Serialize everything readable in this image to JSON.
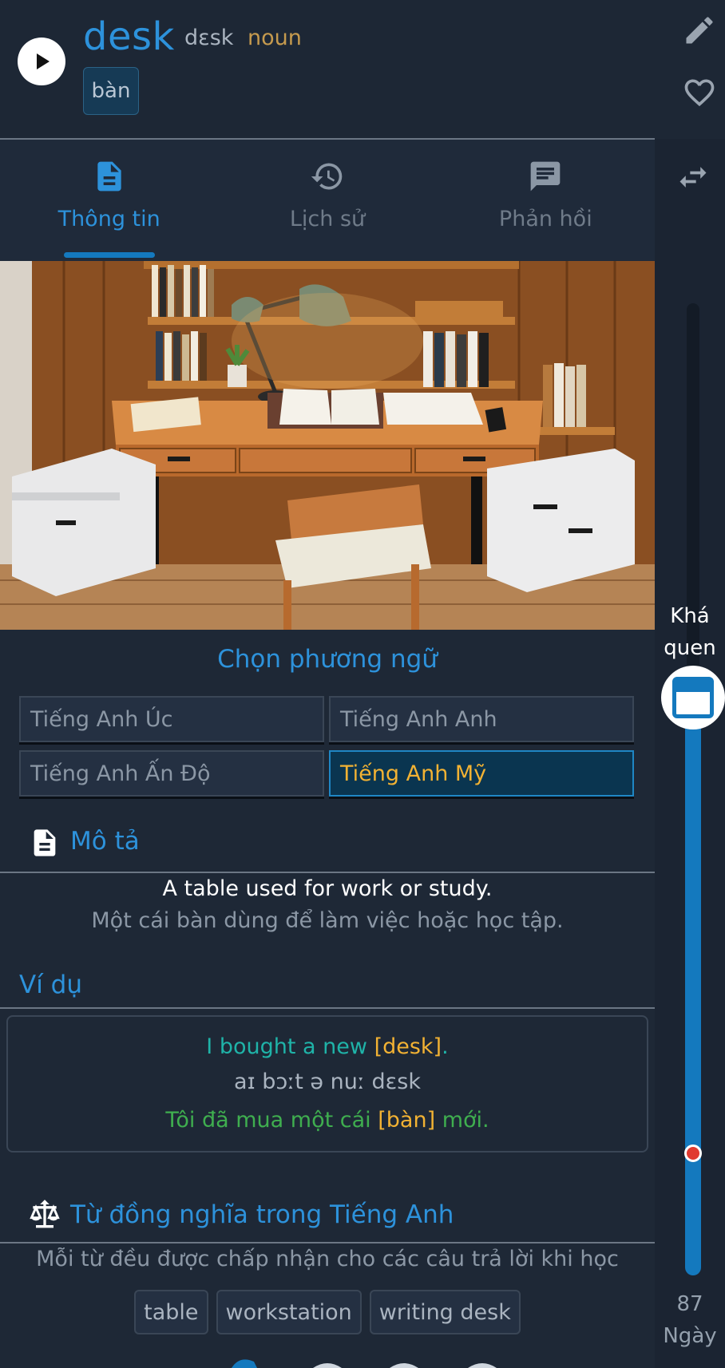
{
  "header": {
    "word": "desk",
    "ipa": "dɛsk",
    "part_of_speech": "noun",
    "translation": "bàn"
  },
  "tabs": [
    {
      "label": "Thông tin",
      "icon": "document-icon",
      "active": true
    },
    {
      "label": "Lịch sử",
      "icon": "history-icon",
      "active": false
    },
    {
      "label": "Phản hồi",
      "icon": "feedback-icon",
      "active": false
    }
  ],
  "rail": {
    "level_line1": "Khá",
    "level_line2": "quen",
    "days_value": "87",
    "days_unit": "Ngày"
  },
  "dialect": {
    "title": "Chọn phương ngữ",
    "options": [
      {
        "label": "Tiếng Anh Úc",
        "selected": false
      },
      {
        "label": "Tiếng Anh Anh",
        "selected": false
      },
      {
        "label": "Tiếng Anh Ấn Độ",
        "selected": false
      },
      {
        "label": "Tiếng Anh Mỹ",
        "selected": true
      }
    ]
  },
  "description": {
    "title": "Mô tả",
    "english": "A table used for work or study.",
    "vietnamese": "Một cái bàn dùng để làm việc hoặc học tập."
  },
  "examples": {
    "title": "Ví dụ",
    "en_before": "I bought a new ",
    "en_highlight": "[desk]",
    "en_after": ".",
    "ipa": "aɪ bɔːt ə nuː dɛsk",
    "vi_before": "Tôi đã mua một cái ",
    "vi_highlight": "[bàn]",
    "vi_after": " mới."
  },
  "synonyms": {
    "title": "Từ đồng nghĩa trong Tiếng Anh",
    "note": "Mỗi từ đều được chấp nhận cho các câu trả lời khi học",
    "items": [
      "table",
      "workstation",
      "writing desk"
    ]
  },
  "colors": {
    "accent": "#2d92db",
    "highlight": "#f2b233",
    "example_en": "#1fb3a8",
    "example_vi": "#3fae4f",
    "background": "#1e2836"
  }
}
